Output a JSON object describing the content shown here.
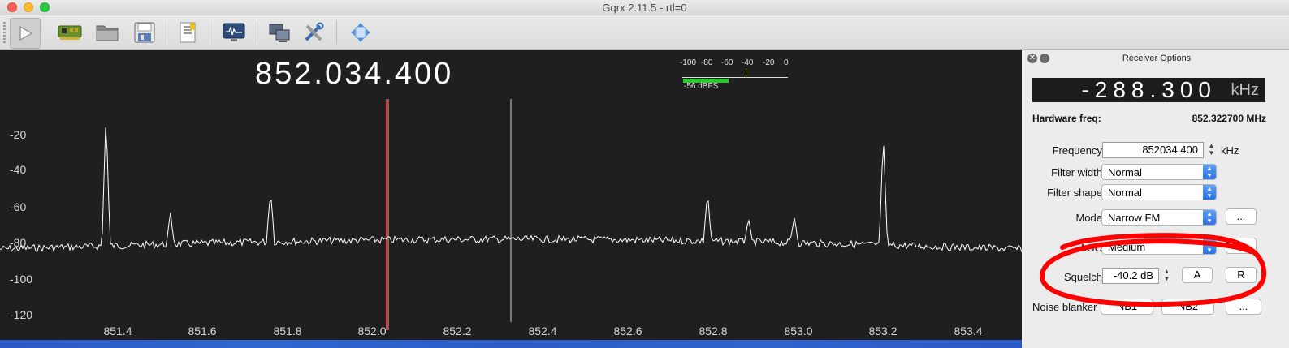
{
  "window": {
    "title": "Gqrx 2.11.5 - rtl=0"
  },
  "toolbar": {
    "buttons": [
      {
        "name": "play-button-icon",
        "active": true
      },
      {
        "name": "input-device-icon"
      },
      {
        "name": "open-folder-icon"
      },
      {
        "name": "save-icon"
      },
      {
        "name": "bookmark-icon"
      },
      {
        "name": "fft-display-icon"
      },
      {
        "name": "network-remote-icon"
      },
      {
        "name": "tools-icon"
      },
      {
        "name": "move-icon"
      }
    ]
  },
  "spectrum": {
    "frequency": "852.034.400",
    "y_ticks": [
      "-20",
      "-40",
      "-60",
      "-80",
      "-100",
      "-120"
    ],
    "x_ticks": [
      "851.4",
      "851.6",
      "851.8",
      "852.0",
      "852.2",
      "852.4",
      "852.6",
      "852.8",
      "853.0",
      "853.2",
      "853.4"
    ],
    "colors": {
      "background": "#1f1f1f",
      "trace": "#ffffff",
      "demod_marker": "#e04040",
      "center_line": "#d0d0d0"
    }
  },
  "meter": {
    "ticks": [
      "-100",
      "-80",
      "-60",
      "-40",
      "-20",
      "0"
    ],
    "level_label": "-56 dBFS",
    "bar_color": "#2ec82e",
    "squelch_marker_color": "#e6d23c"
  },
  "panel": {
    "title": "Receiver Options",
    "offset_value": "-288.300",
    "offset_unit": "kHz",
    "hw_freq_label": "Hardware freq:",
    "hw_freq_value": "852.322700 MHz",
    "frequency_label": "Frequency",
    "frequency_value": "852034.400",
    "frequency_unit": "kHz",
    "filter_width_label": "Filter width",
    "filter_width_value": "Normal",
    "filter_shape_label": "Filter shape",
    "filter_shape_value": "Normal",
    "mode_label": "Mode",
    "mode_value": "Narrow FM",
    "more_label": "...",
    "agc_label": "AGC",
    "agc_value": "Medium",
    "squelch_label": "Squelch",
    "squelch_value": "-40.2 dB",
    "auto_label": "A",
    "reset_label": "R",
    "noise_blanker_label": "Noise blanker",
    "nb1_label": "NB1",
    "nb2_label": "NB2",
    "highlight_color": "#ff0000"
  }
}
